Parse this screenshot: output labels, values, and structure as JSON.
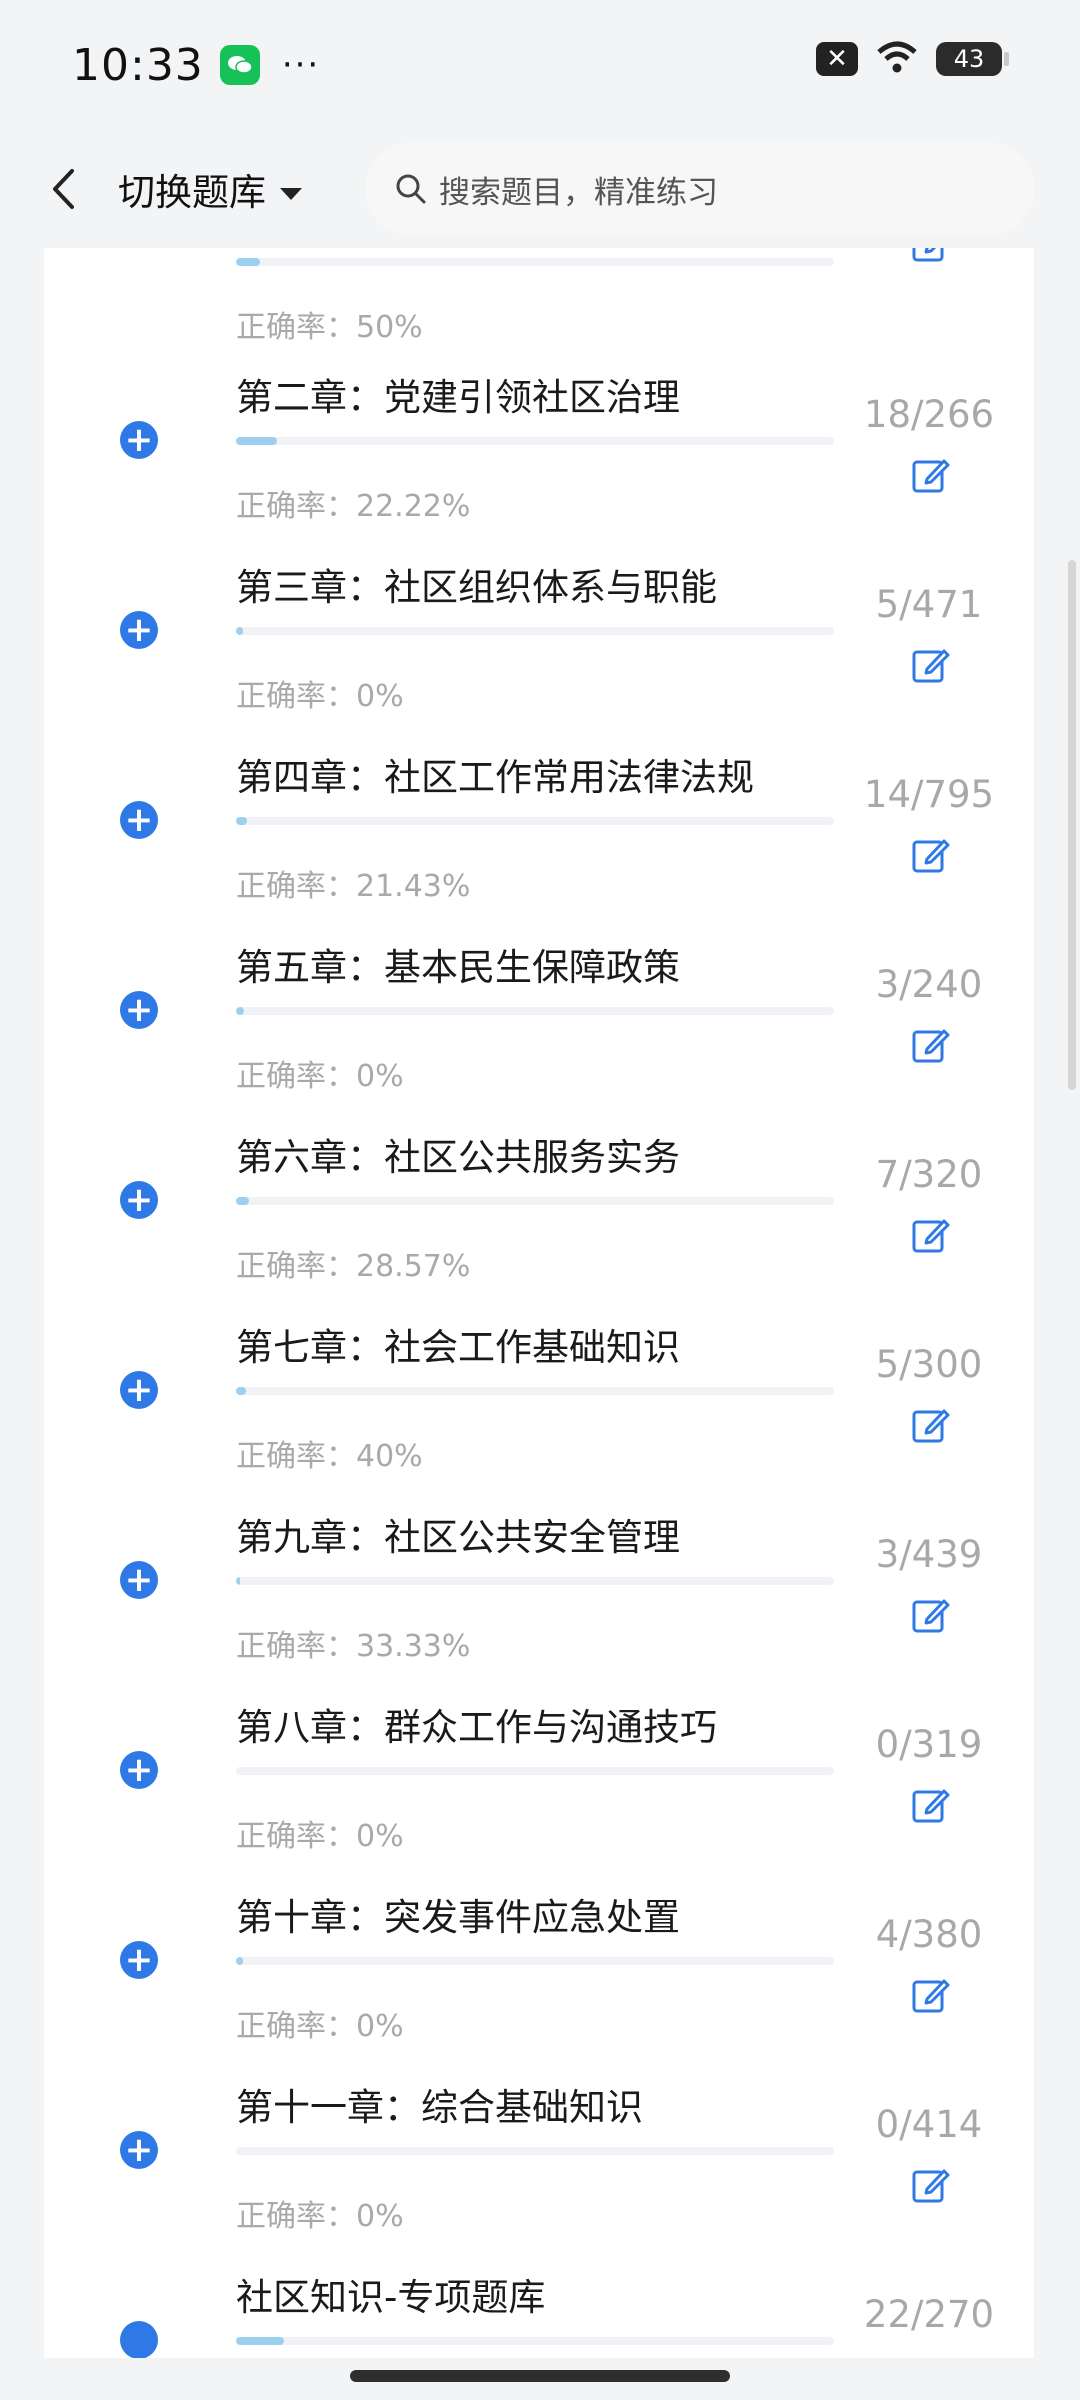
{
  "status_bar": {
    "time": "10:33",
    "dots": "···",
    "battery": "43"
  },
  "nav": {
    "switch_label": "切换题库",
    "search_placeholder": "搜索题目，精准练习"
  },
  "chapters": [
    {
      "title": "",
      "rate_label": "正确率：",
      "rate_value": "50%",
      "count": "",
      "progress": 0.04,
      "partial": true
    },
    {
      "title": "第二章：党建引领社区治理",
      "rate_label": "正确率：",
      "rate_value": "22.22%",
      "count": "18/266",
      "progress": 0.068
    },
    {
      "title": "第三章：社区组织体系与职能",
      "rate_label": "正确率：",
      "rate_value": "0%",
      "count": "5/471",
      "progress": 0.011
    },
    {
      "title": "第四章：社区工作常用法律法规",
      "rate_label": "正确率：",
      "rate_value": "21.43%",
      "count": "14/795",
      "progress": 0.018
    },
    {
      "title": "第五章：基本民生保障政策",
      "rate_label": "正确率：",
      "rate_value": "0%",
      "count": "3/240",
      "progress": 0.013
    },
    {
      "title": "第六章：社区公共服务实务",
      "rate_label": "正确率：",
      "rate_value": "28.57%",
      "count": "7/320",
      "progress": 0.022
    },
    {
      "title": "第七章：社会工作基础知识",
      "rate_label": "正确率：",
      "rate_value": "40%",
      "count": "5/300",
      "progress": 0.017
    },
    {
      "title": "第九章：社区公共安全管理",
      "rate_label": "正确率：",
      "rate_value": "33.33%",
      "count": "3/439",
      "progress": 0.007
    },
    {
      "title": "第八章：群众工作与沟通技巧",
      "rate_label": "正确率：",
      "rate_value": "0%",
      "count": "0/319",
      "progress": 0
    },
    {
      "title": "第十章：突发事件应急处置",
      "rate_label": "正确率：",
      "rate_value": "0%",
      "count": "4/380",
      "progress": 0.011
    },
    {
      "title": "第十一章：综合基础知识",
      "rate_label": "正确率：",
      "rate_value": "0%",
      "count": "0/414",
      "progress": 0
    },
    {
      "title": "社区知识-专项题库",
      "rate_label": "",
      "rate_value": "",
      "count": "22/270",
      "progress": 0.081,
      "partial": true
    }
  ],
  "colors": {
    "accent": "#2f79e6",
    "progress_fill": "#9dd0ef"
  }
}
